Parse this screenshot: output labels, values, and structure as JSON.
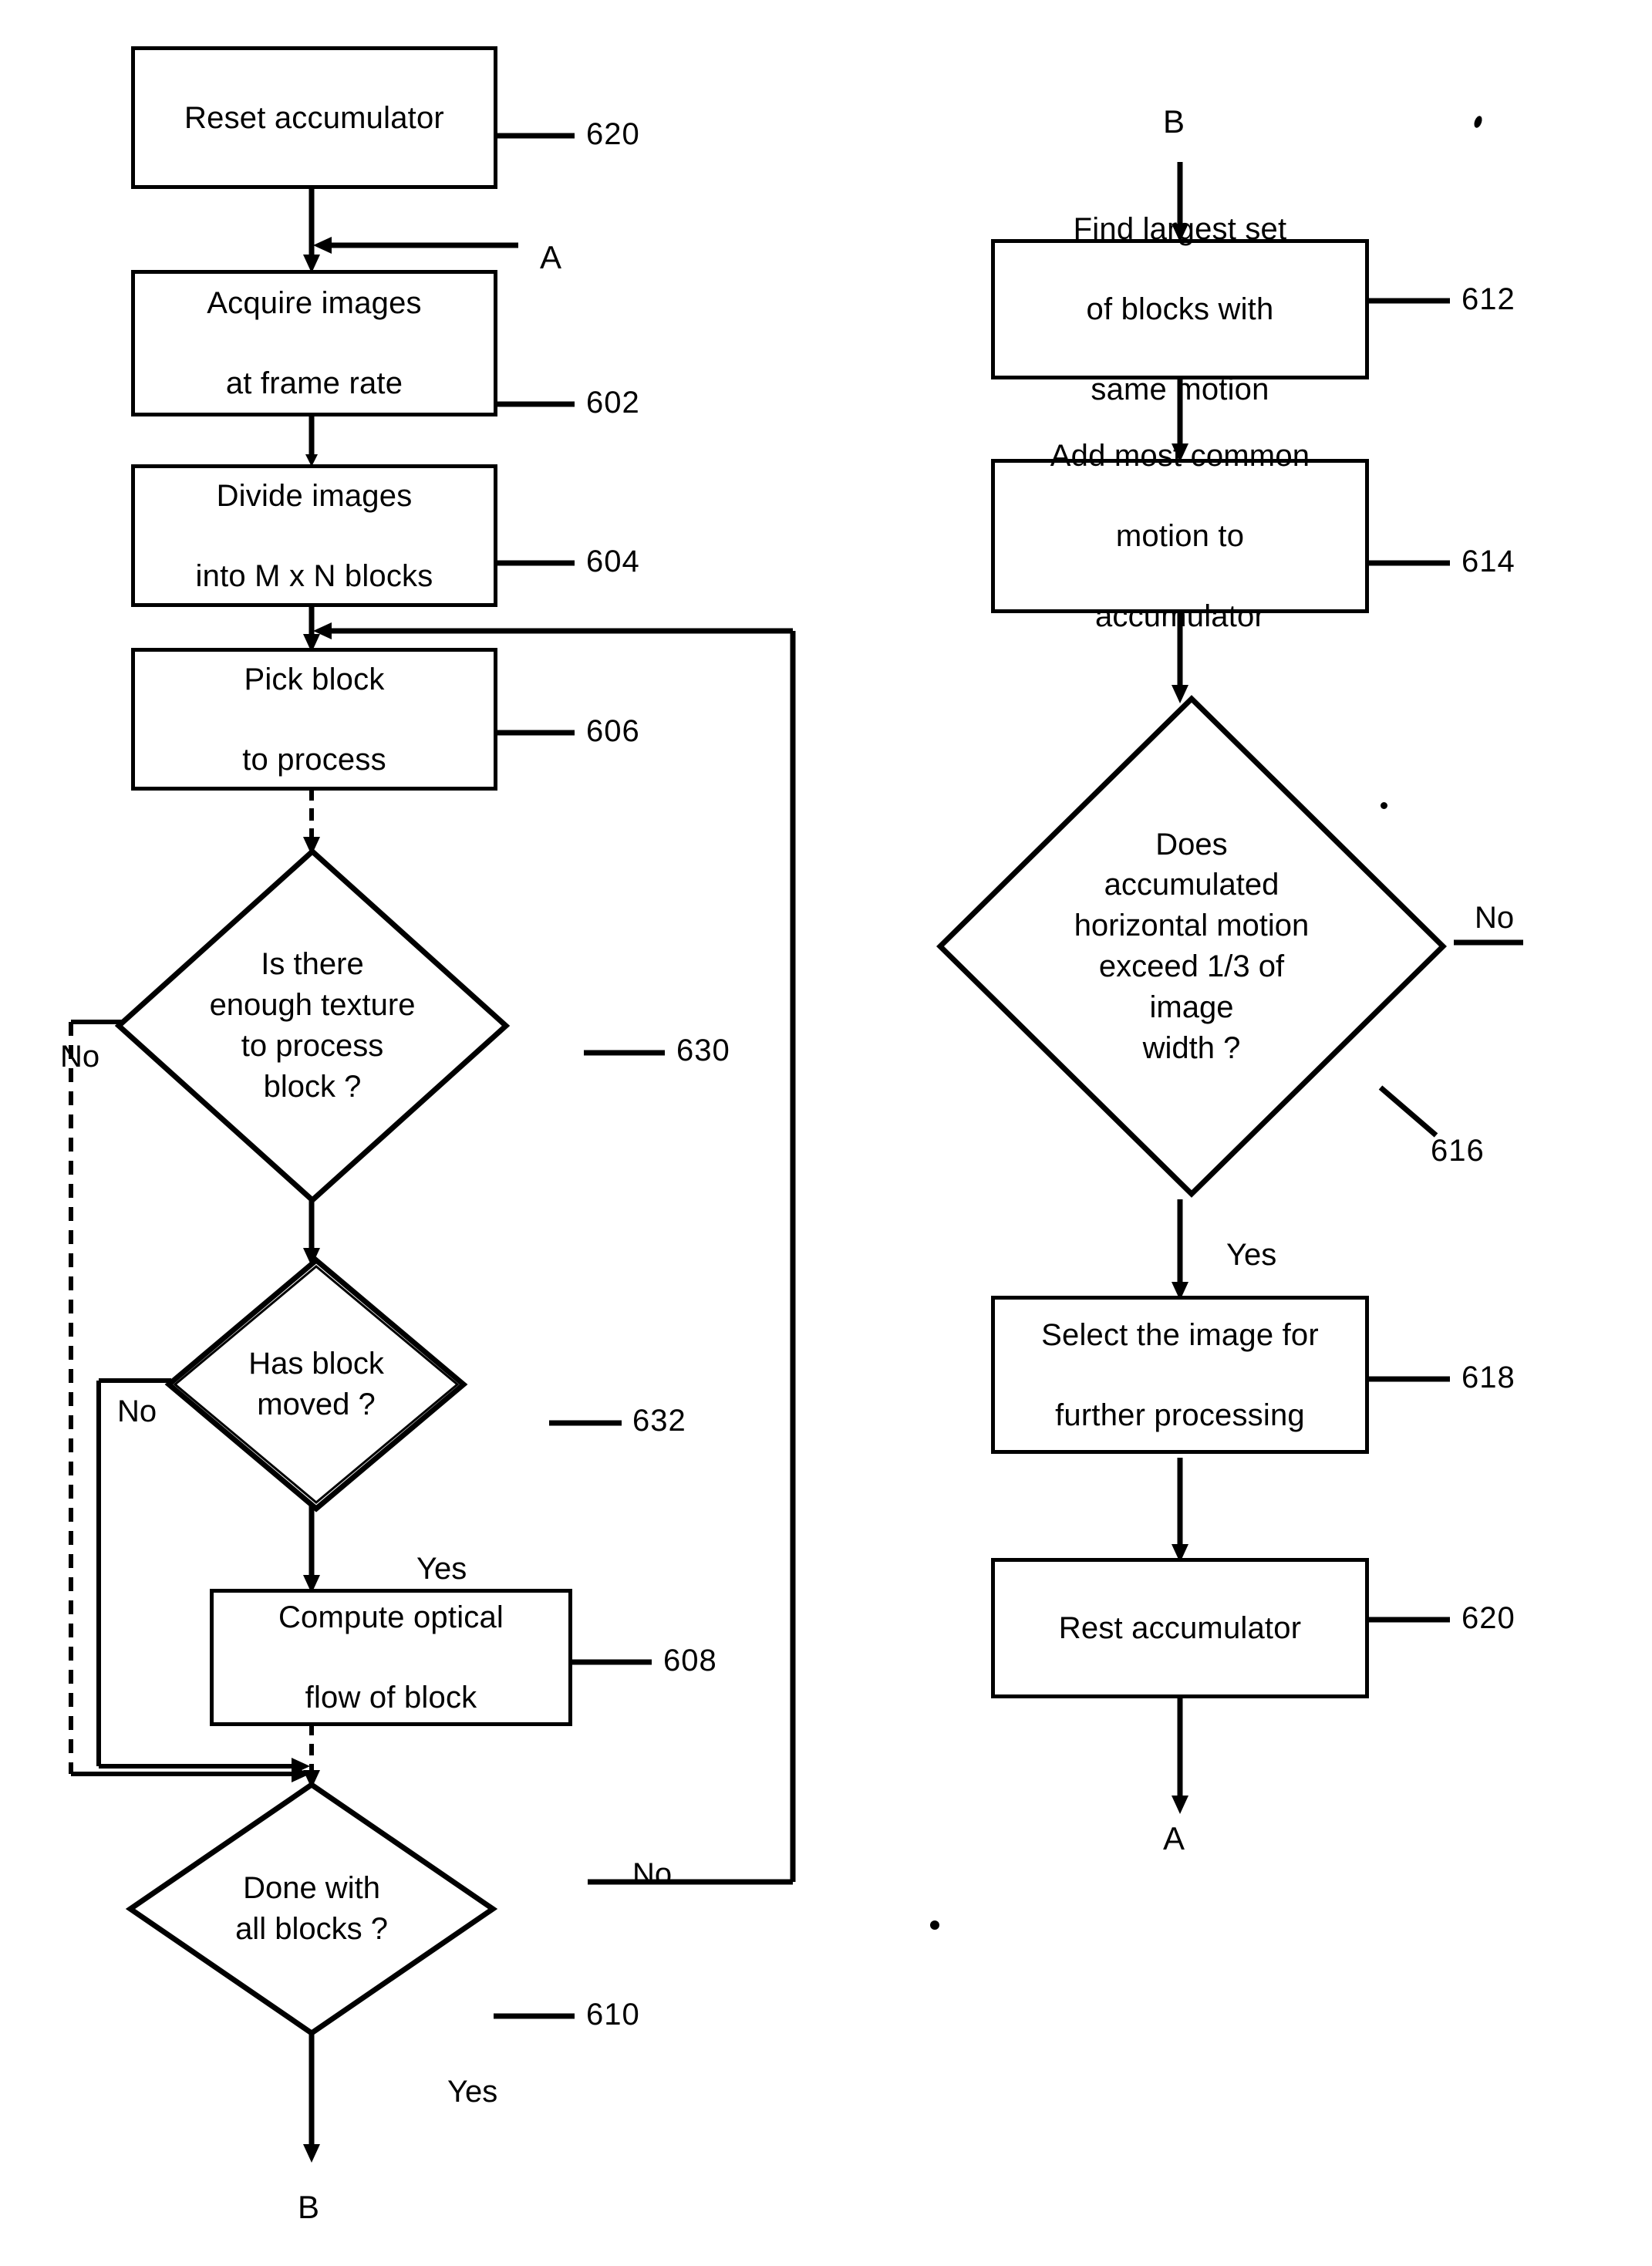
{
  "figure": {
    "type": "patent-flowchart",
    "title": "Optical flow based image selection flowchart",
    "background": "#ffffff",
    "ink": "#000000"
  },
  "left_column": {
    "nodes": [
      {
        "id": "n620a",
        "shape": "process",
        "label_line1": "Reset accumulator",
        "label_line2": "",
        "ref": "620"
      },
      {
        "id": "n602",
        "shape": "process",
        "label_line1": "Acquire images",
        "label_line2": "at frame rate",
        "ref": "602"
      },
      {
        "id": "n604",
        "shape": "process",
        "label_line1": "Divide images",
        "label_line2": "into M x N blocks",
        "ref": "604"
      },
      {
        "id": "n606",
        "shape": "process",
        "label_line1": "Pick block",
        "label_line2": "to process",
        "ref": "606"
      },
      {
        "id": "n630",
        "shape": "decision",
        "label_line1": "Is there",
        "label_line2": "enough texture",
        "label_line3": "to process",
        "label_line4": "block ?",
        "ref": "630"
      },
      {
        "id": "n632",
        "shape": "decision",
        "label_line1": "Has block",
        "label_line2": "moved ?",
        "ref": "632"
      },
      {
        "id": "n608",
        "shape": "process",
        "label_line1": "Compute optical",
        "label_line2": "flow of block",
        "ref": "608"
      },
      {
        "id": "n610",
        "shape": "decision",
        "label_line1": "Done with",
        "label_line2": "all blocks ?",
        "ref": "610"
      }
    ],
    "edge_labels": {
      "a_connector": "A",
      "texture_no": "No",
      "moved_no": "No",
      "moved_yes": "Yes",
      "done_no": "No",
      "done_yes": "Yes"
    },
    "terminator": "B"
  },
  "right_column": {
    "entry_connector": "B",
    "nodes": [
      {
        "id": "n612",
        "shape": "process",
        "label_line1": "Find largest set",
        "label_line2": "of blocks with",
        "label_line3": "same motion",
        "ref": "612"
      },
      {
        "id": "n614",
        "shape": "process",
        "label_line1": "Add most common",
        "label_line2": "motion to",
        "label_line3": "accumulator",
        "ref": "614"
      },
      {
        "id": "n616",
        "shape": "decision",
        "label_line1": "Does",
        "label_line2": "accumulated",
        "label_line3": "horizontal motion",
        "label_line4": "exceed 1/3 of",
        "label_line5": "image",
        "label_line6": "width ?",
        "ref": "616"
      },
      {
        "id": "n618",
        "shape": "process",
        "label_line1": "Select the image for",
        "label_line2": "further processing",
        "ref": "618"
      },
      {
        "id": "n620b",
        "shape": "process",
        "label_line1": "Rest accumulator",
        "label_line2": "",
        "ref": "620"
      }
    ],
    "edge_labels": {
      "exceed_no": "No",
      "exceed_yes": "Yes"
    },
    "terminator": "A"
  }
}
